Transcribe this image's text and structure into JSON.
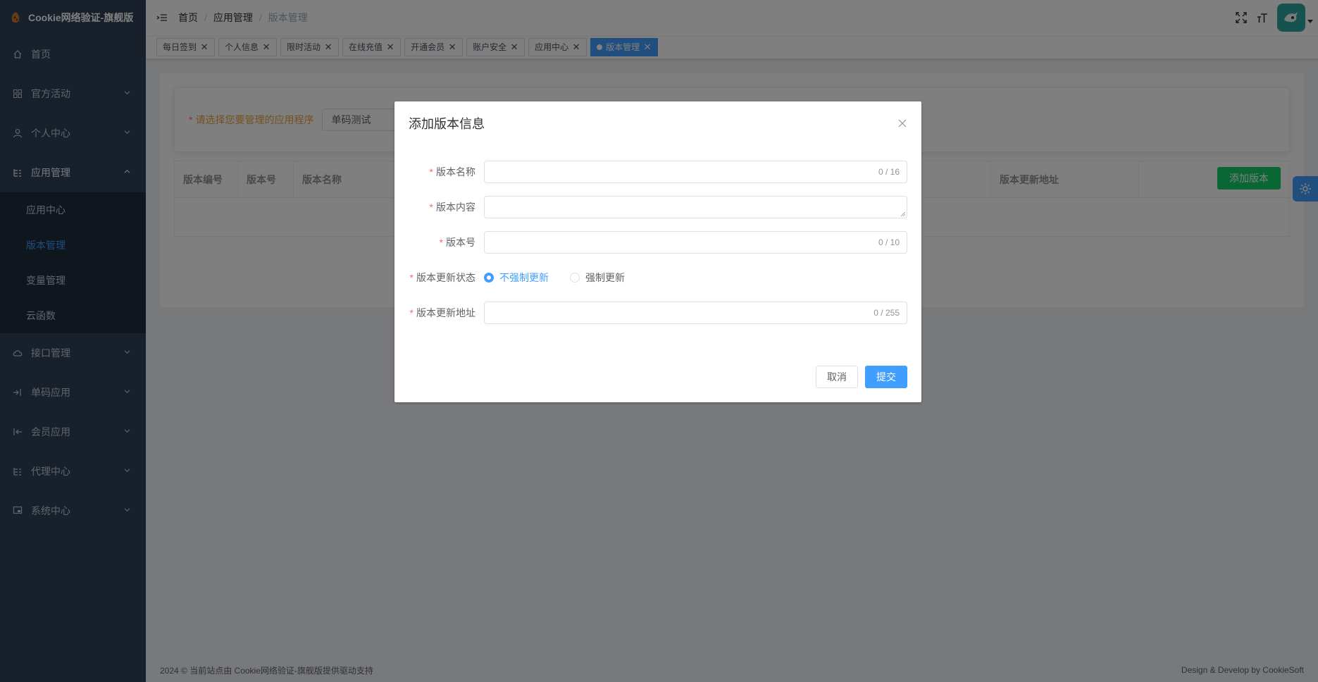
{
  "app": {
    "title": "Cookie网络验证-旗舰版"
  },
  "sidebar": {
    "items": [
      {
        "label": "首页",
        "icon": "home-icon"
      },
      {
        "label": "官方活动",
        "icon": "grid-icon"
      },
      {
        "label": "个人中心",
        "icon": "user-icon"
      },
      {
        "label": "应用管理",
        "icon": "tree-icon",
        "expanded": true
      },
      {
        "label": "接口管理",
        "icon": "cloud-icon"
      },
      {
        "label": "单码应用",
        "icon": "login-icon"
      },
      {
        "label": "会员应用",
        "icon": "logout-icon"
      },
      {
        "label": "代理中心",
        "icon": "tree-icon"
      },
      {
        "label": "系统中心",
        "icon": "monitor-icon"
      }
    ],
    "submenu": [
      "应用中心",
      "版本管理",
      "变量管理",
      "云函数"
    ],
    "active_sub": "版本管理"
  },
  "breadcrumb": [
    "首页",
    "应用管理",
    "版本管理"
  ],
  "tags": [
    "每日签到",
    "个人信息",
    "限时活动",
    "在线充值",
    "开通会员",
    "账户安全",
    "应用中心",
    "版本管理"
  ],
  "active_tag": "版本管理",
  "search": {
    "label": "请选择您要管理的应用程序",
    "selected": "单码测试"
  },
  "table": {
    "headers": [
      "版本编号",
      "版本号",
      "版本名称",
      "版本更新地址"
    ],
    "add_button": "添加版本"
  },
  "footer": {
    "left": "2024 © 当前站点由 Cookie网络验证-旗舰版提供驱动支持",
    "right": "Design & Develop by CookieSoft"
  },
  "dialog": {
    "title": "添加版本信息",
    "fields": {
      "name": {
        "label": "版本名称",
        "count": "0 / 16",
        "value": ""
      },
      "content": {
        "label": "版本内容",
        "value": ""
      },
      "version": {
        "label": "版本号",
        "count": "0 / 10",
        "value": ""
      },
      "status": {
        "label": "版本更新状态",
        "options": [
          "不强制更新",
          "强制更新"
        ],
        "selected": "不强制更新"
      },
      "url": {
        "label": "版本更新地址",
        "count": "0 / 255",
        "value": ""
      }
    },
    "cancel": "取消",
    "submit": "提交"
  },
  "colors": {
    "sidebar_bg": "#304156",
    "primary": "#409eff",
    "success": "#13ce66",
    "warning": "#e6a23c",
    "danger": "#f56c6c"
  }
}
